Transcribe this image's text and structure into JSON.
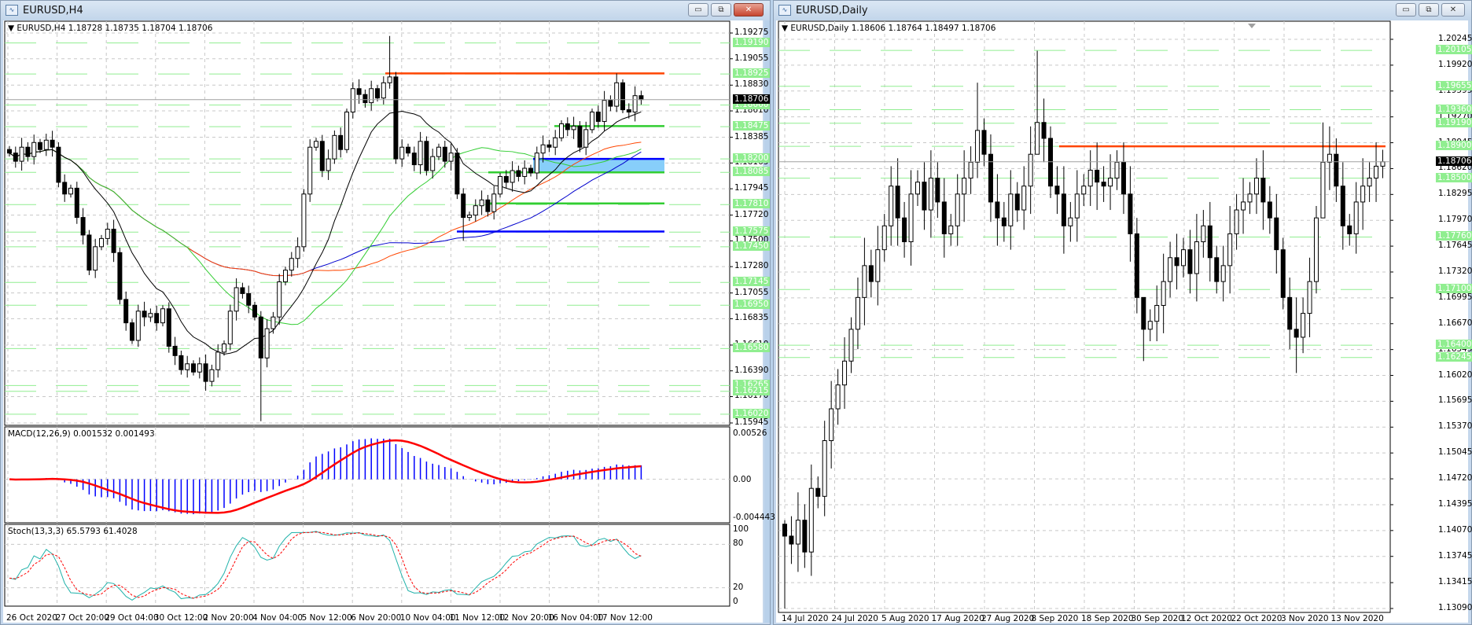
{
  "left_window": {
    "title": "EURUSD,H4",
    "info_line": "▼ EURUSD,H4  1.18728 1.18735 1.18704 1.18706",
    "macd_label": "MACD(12,26,9) 0.001532 0.001493",
    "stoch_label": "Stoch(13,3,3) 65.5793 61.4028",
    "buttons": {
      "minimize": "▭",
      "restore": "⧉",
      "close": "✕"
    },
    "price_labels": [
      "1.19275",
      "1.19055",
      "1.18830",
      "1.18610",
      "1.18385",
      "1.18165",
      "1.17945",
      "1.17720",
      "1.17500",
      "1.17280",
      "1.17055",
      "1.16835",
      "1.16610",
      "1.16390",
      "1.16170",
      "1.15945"
    ],
    "level_labels": [
      "1.19190",
      "1.18925",
      "1.18660",
      "1.18475",
      "1.18200",
      "1.18085",
      "1.17810",
      "1.17575",
      "1.17450",
      "1.17145",
      "1.16950",
      "1.16580",
      "1.16265",
      "1.16215",
      "1.16020"
    ],
    "current_price": "1.18706",
    "macd_axis": [
      "0.00526",
      "0.00",
      "-0.004443"
    ],
    "stoch_axis": [
      "100",
      "80",
      "20",
      "0"
    ],
    "date_labels": [
      "26 Oct 2020",
      "27 Oct 20:00",
      "29 Oct 04:00",
      "30 Oct 12:00",
      "2 Nov 20:00",
      "4 Nov 04:00",
      "5 Nov 12:00",
      "6 Nov 20:00",
      "10 Nov 04:00",
      "11 Nov 12:00",
      "12 Nov 20:00",
      "16 Nov 04:00",
      "17 Nov 12:00"
    ]
  },
  "right_window": {
    "title": "EURUSD,Daily",
    "info_line": "▼ EURUSD,Daily  1.18606 1.18764 1.18497 1.18706",
    "buttons": {
      "minimize": "▭",
      "restore": "⧉",
      "close": "✕"
    },
    "price_labels": [
      "1.20245",
      "1.19920",
      "1.19595",
      "1.19270",
      "1.18945",
      "1.18620",
      "1.18295",
      "1.17970",
      "1.17645",
      "1.17320",
      "1.16995",
      "1.16670",
      "1.16345",
      "1.16020",
      "1.15695",
      "1.15370",
      "1.15045",
      "1.14720",
      "1.14395",
      "1.14070",
      "1.13745",
      "1.13415",
      "1.13090"
    ],
    "level_labels": [
      "1.20105",
      "1.19655",
      "1.19360",
      "1.19190",
      "1.18900",
      "1.18500",
      "1.17760",
      "1.17100",
      "1.16400",
      "1.16245"
    ],
    "current_price": "1.18706",
    "date_labels": [
      "14 Jul 2020",
      "24 Jul 2020",
      "5 Aug 2020",
      "17 Aug 2020",
      "27 Aug 2020",
      "8 Sep 2020",
      "18 Sep 2020",
      "30 Sep 2020",
      "12 Oct 2020",
      "22 Oct 2020",
      "3 Nov 2020",
      "13 Nov 2020"
    ]
  },
  "colors": {
    "bull": "#ffffff",
    "bear": "#000000",
    "level": "#90ee90",
    "resistance": "#ff4500",
    "support_green": "#32cd32",
    "support_blue": "#0000ff",
    "zone": "#87cefa",
    "macd_hist": "#0000ff",
    "macd_signal": "#ff0000",
    "stoch_main": "#20b2aa",
    "stoch_signal": "#ff0000"
  },
  "chart_data": [
    {
      "type": "candlestick",
      "title": "EURUSD,H4",
      "ylim": [
        1.15945,
        1.19275
      ],
      "closes": [
        1.1825,
        1.1818,
        1.183,
        1.1822,
        1.1834,
        1.1828,
        1.1836,
        1.183,
        1.18,
        1.179,
        1.1795,
        1.177,
        1.1755,
        1.1725,
        1.1745,
        1.1752,
        1.176,
        1.174,
        1.17,
        1.168,
        1.1665,
        1.169,
        1.1685,
        1.1688,
        1.168,
        1.1692,
        1.166,
        1.1652,
        1.164,
        1.1645,
        1.1638,
        1.1645,
        1.163,
        1.164,
        1.1655,
        1.1662,
        1.169,
        1.171,
        1.1705,
        1.1695,
        1.1685,
        1.165,
        1.1675,
        1.1685,
        1.1715,
        1.1725,
        1.1735,
        1.1745,
        1.179,
        1.183,
        1.1835,
        1.181,
        1.182,
        1.184,
        1.1828,
        1.186,
        1.188,
        1.1875,
        1.1868,
        1.188,
        1.1872,
        1.1885,
        1.189,
        1.182,
        1.183,
        1.1825,
        1.1815,
        1.1835,
        1.181,
        1.1822,
        1.183,
        1.1818,
        1.1825,
        1.179,
        1.177,
        1.1772,
        1.178,
        1.1785,
        1.1775,
        1.179,
        1.1805,
        1.18,
        1.181,
        1.1805,
        1.1812,
        1.1808,
        1.1825,
        1.1832,
        1.183,
        1.1838,
        1.185,
        1.1845,
        1.1848,
        1.183,
        1.1845,
        1.186,
        1.1852,
        1.187,
        1.1865,
        1.1885,
        1.1862,
        1.186,
        1.1874,
        1.18706
      ],
      "wick_overrides": {
        "41": [
          1.169,
          1.1596
        ],
        "62": [
          1.1925,
          1.188
        ],
        "74": [
          1.1795,
          1.175
        ],
        "99": [
          1.1893,
          1.186
        ]
      },
      "levels": {
        "resistance": 1.1893,
        "green_upper": 1.1848,
        "zone_top": 1.182,
        "zone_bottom": 1.18085,
        "green_lower": 1.1782,
        "blue_lower": 1.1758
      },
      "indicators": [
        "SMA 12",
        "SMA 30",
        "SMA 50",
        "SMA 60",
        "MACD(12,26,9)",
        "Stoch(13,3,3)"
      ]
    },
    {
      "type": "candlestick",
      "title": "EURUSD,Daily",
      "ylim": [
        1.1309,
        1.20245
      ],
      "closes": [
        1.14,
        1.139,
        1.142,
        1.138,
        1.146,
        1.145,
        1.152,
        1.156,
        1.159,
        1.162,
        1.166,
        1.17,
        1.174,
        1.172,
        1.176,
        1.179,
        1.184,
        1.18,
        1.177,
        1.183,
        1.1845,
        1.181,
        1.185,
        1.182,
        1.178,
        1.179,
        1.183,
        1.185,
        1.187,
        1.191,
        1.188,
        1.182,
        1.18,
        1.179,
        1.183,
        1.181,
        1.184,
        1.188,
        1.192,
        1.19,
        1.184,
        1.183,
        1.179,
        1.18,
        1.183,
        1.184,
        1.186,
        1.1845,
        1.184,
        1.185,
        1.187,
        1.183,
        1.178,
        1.17,
        1.166,
        1.167,
        1.169,
        1.172,
        1.175,
        1.174,
        1.176,
        1.173,
        1.177,
        1.179,
        1.175,
        1.172,
        1.174,
        1.178,
        1.181,
        1.182,
        1.183,
        1.185,
        1.182,
        1.18,
        1.176,
        1.17,
        1.166,
        1.165,
        1.168,
        1.172,
        1.18,
        1.187,
        1.188,
        1.184,
        1.179,
        1.178,
        1.182,
        1.184,
        1.185,
        1.1865,
        1.18706
      ],
      "wick_overrides": {
        "0": [
          1.142,
          1.1309
        ],
        "29": [
          1.197,
          1.185
        ],
        "38": [
          1.201,
          1.188
        ],
        "54": [
          1.17,
          1.162
        ],
        "77": [
          1.17,
          1.1605
        ],
        "81": [
          1.192,
          1.18
        ]
      },
      "levels": {
        "resistance": 1.189
      }
    }
  ]
}
